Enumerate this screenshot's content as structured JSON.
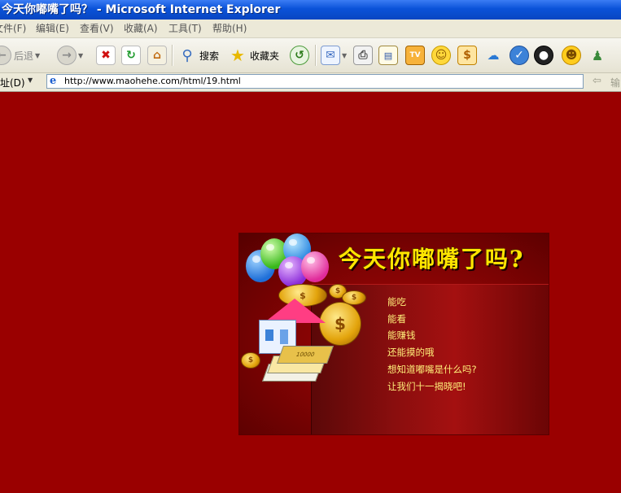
{
  "window": {
    "title": "今天你嘟嘴了吗？ - Microsoft Internet Explorer"
  },
  "menu": {
    "file": "文件(F)",
    "edit": "编辑(E)",
    "view": "查看(V)",
    "favorites": "收藏(A)",
    "tools": "工具(T)",
    "help": "帮助(H)"
  },
  "toolbar": {
    "back_label": "后退",
    "search_label": "搜索",
    "favorites_label": "收藏夹"
  },
  "address": {
    "label": "址(D)",
    "url": "http://www.maohehe.com/html/19.html",
    "go_label": "输"
  },
  "banner": {
    "title": "今天你嘟嘴了吗?",
    "coin_symbol": "$",
    "cash_note": "10000",
    "lines": [
      "能吃",
      "能看",
      "能赚钱",
      "还能摸的哦",
      "想知道嘟嘴是什么吗?",
      "让我们十一揭晓吧!"
    ]
  },
  "colors": {
    "page_background": "#9a0000",
    "banner_title": "#ffe600",
    "banner_text": "#ffef7a"
  }
}
